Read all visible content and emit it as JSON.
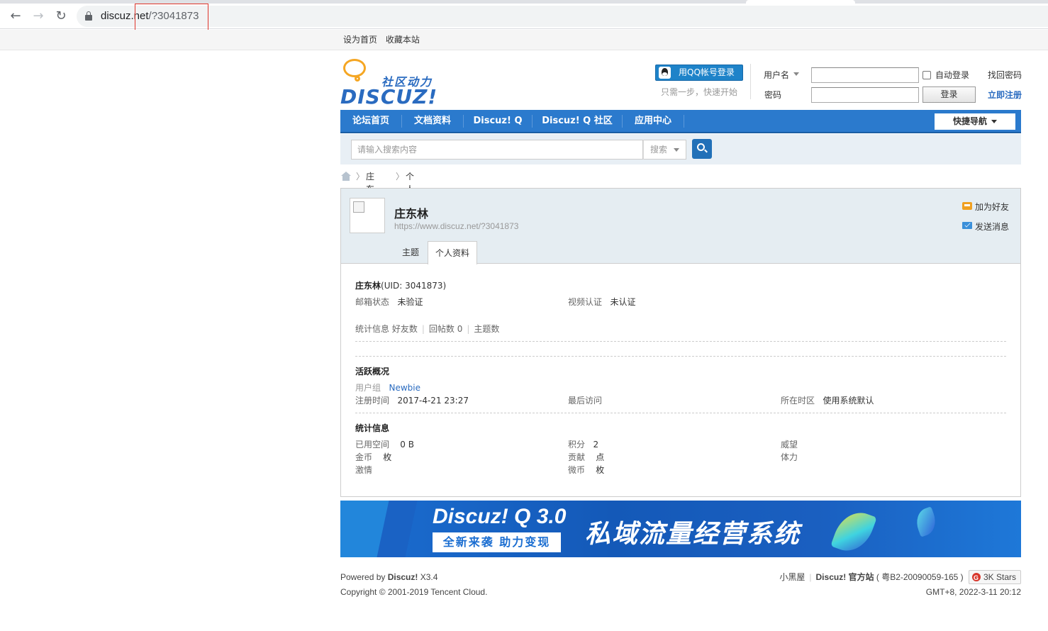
{
  "browser": {
    "url_host": "discuz.net",
    "url_path": "/?3041873",
    "back_icon": "arrow-left",
    "forward_icon": "arrow-right",
    "reload_icon": "reload",
    "lock_icon": "lock"
  },
  "topbar": {
    "links": [
      "设为首页",
      "收藏本站"
    ]
  },
  "header": {
    "logo_sub": "社区动力",
    "logo_brand": "DISCUZ!",
    "qq_login": "用QQ帐号登录",
    "qq_tip": "只需一步，快速开始",
    "username_label": "用户名",
    "password_label": "密码",
    "auto_login": "自动登录",
    "forgot_password": "找回密码",
    "login_button": "登录",
    "register": "立即注册"
  },
  "nav": {
    "items": [
      "论坛首页",
      "文档资料",
      "Discuz! Q",
      "Discuz! Q 社区",
      "应用中心"
    ],
    "quick_nav": "快捷导航"
  },
  "search": {
    "placeholder": "请输入搜索内容",
    "type": "搜索",
    "button_icon": "search-icon"
  },
  "breadcrumb": {
    "home_icon": "home-icon",
    "sep": "〉",
    "items": [
      "庄东林",
      "个人资料"
    ]
  },
  "profile": {
    "name": "庄东林",
    "url": "https://www.discuz.net/?3041873",
    "add_friend": "加为好友",
    "send_message": "发送消息",
    "tabs": [
      "主题",
      "个人资料"
    ],
    "active_tab": "个人资料",
    "uid_name": "庄东林",
    "uid_text": "(UID: 3041873)",
    "email_status_label": "邮箱状态",
    "email_status_value": "未验证",
    "video_auth_label": "视频认证",
    "video_auth_value": "未认证",
    "stats_label": "统计信息",
    "friends_label": "好友数",
    "replies_label": "回帖数 0",
    "topics_label": "主题数",
    "activity_title": "活跃概况",
    "usergroup_label": "用户组",
    "usergroup_value": "Newbie",
    "regtime_label": "注册时间",
    "regtime_value": "2017-4-21 23:27",
    "lastvisit_label": "最后访问",
    "timezone_label": "所在时区",
    "timezone_value": "使用系统默认",
    "stats_title": "统计信息",
    "space_label": "已用空间",
    "space_value": "0 B",
    "credits_label": "积分",
    "credits_value": "2",
    "prestige_label": "威望",
    "gold_label": "金币",
    "gold_unit": "枚",
    "contrib_label": "贡献",
    "contrib_unit": "点",
    "stamina_label": "体力",
    "passion_label": "激情",
    "microcoin_label": "微币",
    "microcoin_unit": "枚"
  },
  "banner": {
    "title": "Discuz! Q 3.0",
    "tag": "全新来袭 助力变现",
    "slogan": "私域流量经营系统"
  },
  "footer": {
    "powered_prefix": "Powered by ",
    "powered_brand": "Discuz!",
    "powered_version": " X3.4",
    "copyright": "Copyright © 2001-2019 Tencent Cloud.",
    "link1": "小黑屋",
    "link2": "Discuz! 官方站",
    "icp": "( 粤B2-20090059-165 )",
    "stars": "3K Stars",
    "time": "GMT+8, 2022-3-11 20:12"
  }
}
